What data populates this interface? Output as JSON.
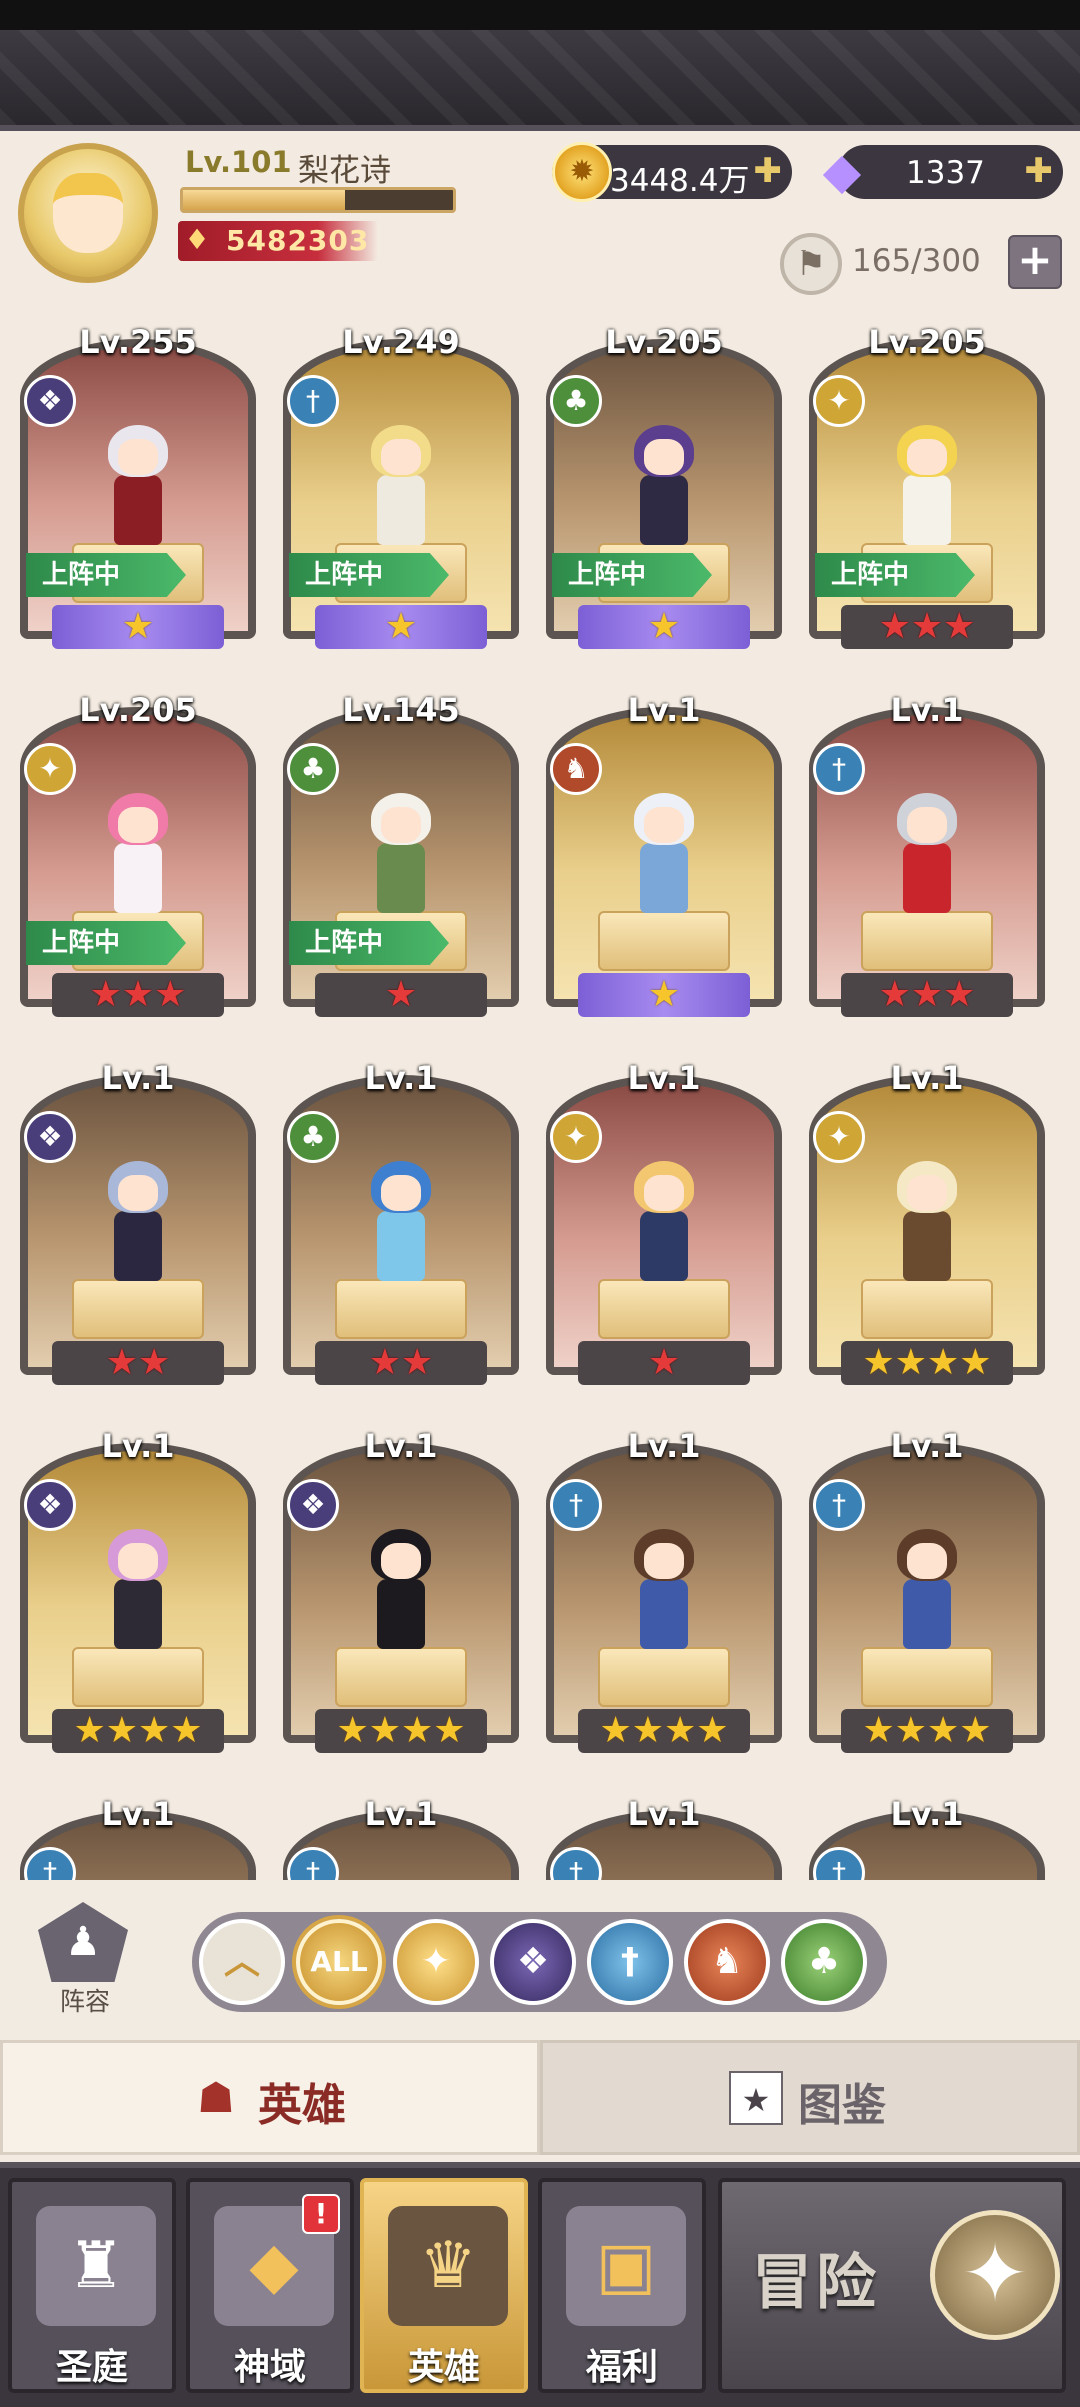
{
  "player": {
    "level": "Lv.101",
    "name": "梨花诗",
    "power": "5482303",
    "xp_fraction": 0.6
  },
  "currency": {
    "coins": "3448.4万",
    "gems": "1337"
  },
  "capacity": "165/300",
  "heroes": [
    {
      "level": "Lv.255",
      "element": "dark",
      "deployed": true,
      "deploy_label": "上阵中",
      "stars": 1,
      "star_style": "purple",
      "bg": "red",
      "hair": "#e9e6ee",
      "outfit": "#8b1e24"
    },
    {
      "level": "Lv.249",
      "element": "water",
      "deployed": true,
      "deploy_label": "上阵中",
      "stars": 1,
      "star_style": "purple",
      "bg": "gold",
      "hair": "#f2dc8a",
      "outfit": "#efeae0"
    },
    {
      "level": "Lv.205",
      "element": "nature",
      "deployed": true,
      "deploy_label": "上阵中",
      "stars": 1,
      "star_style": "purple",
      "bg": "brown",
      "hair": "#5b3f8e",
      "outfit": "#2f2a44"
    },
    {
      "level": "Lv.205",
      "element": "light",
      "deployed": true,
      "deploy_label": "上阵中",
      "stars": 3,
      "star_style": "red",
      "bg": "gold",
      "hair": "#f3d34f",
      "outfit": "#f5f2ea"
    },
    {
      "level": "Lv.205",
      "element": "light",
      "deployed": true,
      "deploy_label": "上阵中",
      "stars": 3,
      "star_style": "red",
      "bg": "red",
      "hair": "#f07aa8",
      "outfit": "#f8f1f5"
    },
    {
      "level": "Lv.145",
      "element": "nature",
      "deployed": true,
      "deploy_label": "上阵中",
      "stars": 1,
      "star_style": "red",
      "bg": "brown",
      "hair": "#f3f1ea",
      "outfit": "#6a8b4e"
    },
    {
      "level": "Lv.1",
      "element": "fire",
      "deployed": false,
      "deploy_label": "",
      "stars": 1,
      "star_style": "purple",
      "bg": "gold",
      "hair": "#eef0f7",
      "outfit": "#7aa7d8"
    },
    {
      "level": "Lv.1",
      "element": "water",
      "deployed": false,
      "deploy_label": "",
      "stars": 3,
      "star_style": "red",
      "bg": "red",
      "hair": "#cfd2d8",
      "outfit": "#c8252c"
    },
    {
      "level": "Lv.1",
      "element": "dark",
      "deployed": false,
      "deploy_label": "",
      "stars": 2,
      "star_style": "red",
      "bg": "brown",
      "hair": "#a9b7d8",
      "outfit": "#2b2740"
    },
    {
      "level": "Lv.1",
      "element": "nature",
      "deployed": false,
      "deploy_label": "",
      "stars": 2,
      "star_style": "red",
      "bg": "brown",
      "hair": "#3f7fcf",
      "outfit": "#7ec6ea"
    },
    {
      "level": "Lv.1",
      "element": "light",
      "deployed": false,
      "deploy_label": "",
      "stars": 1,
      "star_style": "red",
      "bg": "red",
      "hair": "#f2c770",
      "outfit": "#2d3a66"
    },
    {
      "level": "Lv.1",
      "element": "light",
      "deployed": false,
      "deploy_label": "",
      "stars": 4,
      "star_style": "gold",
      "bg": "gold",
      "hair": "#f5e9c5",
      "outfit": "#6b4b30"
    },
    {
      "level": "Lv.1",
      "element": "dark",
      "deployed": false,
      "deploy_label": "",
      "stars": 4,
      "star_style": "gold",
      "bg": "gold",
      "hair": "#d79ad8",
      "outfit": "#2e2a35"
    },
    {
      "level": "Lv.1",
      "element": "dark",
      "deployed": false,
      "deploy_label": "",
      "stars": 4,
      "star_style": "gold",
      "bg": "brown",
      "hair": "#1c1a1e",
      "outfit": "#1c1a1e"
    },
    {
      "level": "Lv.1",
      "element": "water",
      "deployed": false,
      "deploy_label": "",
      "stars": 4,
      "star_style": "gold",
      "bg": "brown",
      "hair": "#5d3d2a",
      "outfit": "#3f5aa8"
    },
    {
      "level": "Lv.1",
      "element": "water",
      "deployed": false,
      "deploy_label": "",
      "stars": 4,
      "star_style": "gold",
      "bg": "brown",
      "hair": "#5d3d2a",
      "outfit": "#3f5aa8"
    },
    {
      "level": "Lv.1",
      "element": "water",
      "deployed": false,
      "deploy_label": "",
      "stars": 0,
      "star_style": "gold",
      "bg": "brown",
      "hair": "#999",
      "outfit": "#999"
    },
    {
      "level": "Lv.1",
      "element": "water",
      "deployed": false,
      "deploy_label": "",
      "stars": 0,
      "star_style": "gold",
      "bg": "brown",
      "hair": "#999",
      "outfit": "#999"
    },
    {
      "level": "Lv.1",
      "element": "water",
      "deployed": false,
      "deploy_label": "",
      "stars": 0,
      "star_style": "gold",
      "bg": "brown",
      "hair": "#999",
      "outfit": "#999"
    },
    {
      "level": "Lv.1",
      "element": "water",
      "deployed": false,
      "deploy_label": "",
      "stars": 0,
      "star_style": "gold",
      "bg": "brown",
      "hair": "#999",
      "outfit": "#999"
    }
  ],
  "filters": {
    "lineup_label": "阵容",
    "all_label": "ALL",
    "items": [
      "sort",
      "all",
      "light",
      "dark",
      "water",
      "fire",
      "nature"
    ]
  },
  "tabs": {
    "hero": "英雄",
    "codex": "图鉴"
  },
  "nav": [
    {
      "label": "圣庭",
      "icon": "castle-icon"
    },
    {
      "label": "神域",
      "icon": "crystal-icon",
      "badge": "!"
    },
    {
      "label": "英雄",
      "icon": "helmet-icon",
      "active": true
    },
    {
      "label": "福利",
      "icon": "chest-icon"
    }
  ],
  "adventure_label": "冒险"
}
